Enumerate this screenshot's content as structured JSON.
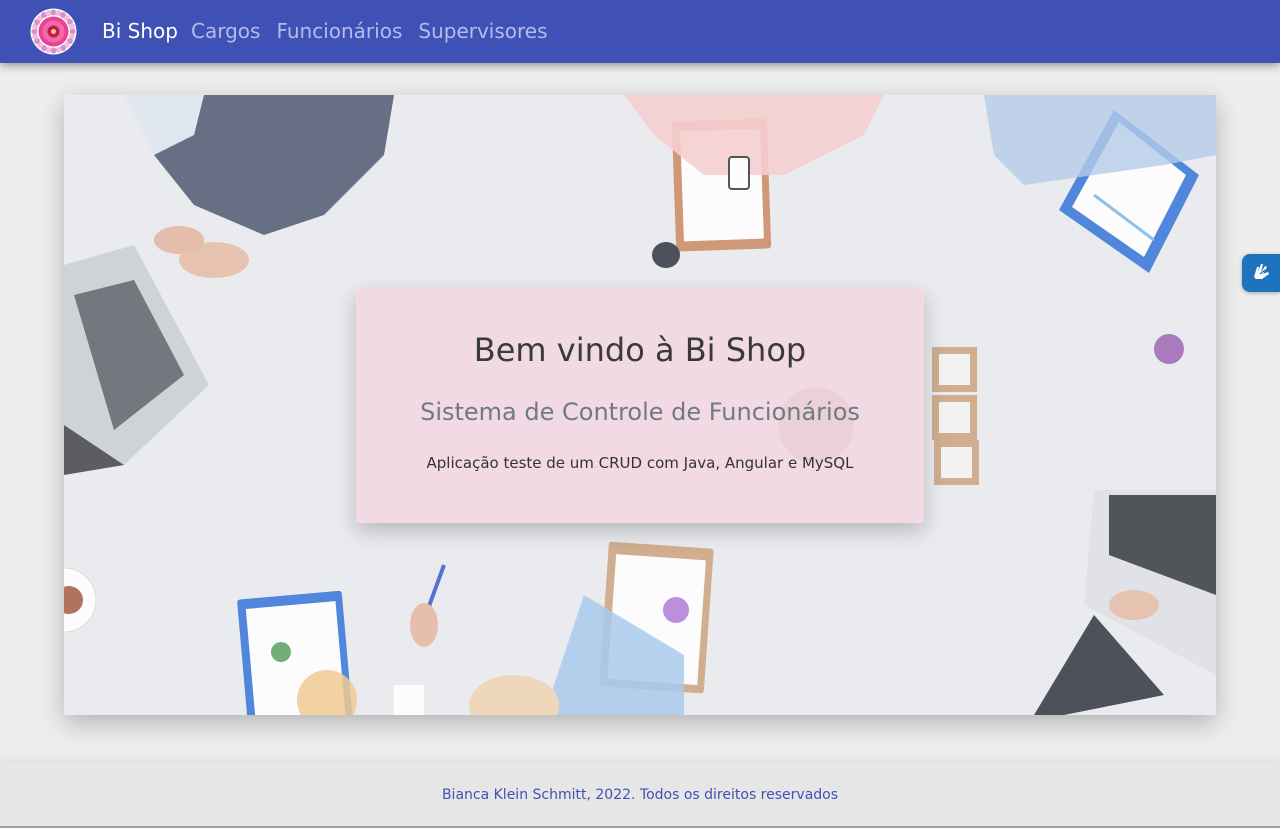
{
  "navbar": {
    "brand": "Bi Shop",
    "links": [
      {
        "label": "Cargos"
      },
      {
        "label": "Funcionários"
      },
      {
        "label": "Supervisores"
      }
    ],
    "logo_icon": "flower-mandala-icon"
  },
  "hero": {
    "title": "Bem vindo à Bi Shop",
    "subtitle": "Sistema de Controle de Funcionários",
    "description": "Aplicação teste de um CRUD com Java, Angular e MySQL",
    "background_image": "office-meeting-top-view"
  },
  "accessibility_widget": {
    "icon": "sign-language-hands-icon"
  },
  "footer": {
    "text": "Bianca Klein Schmitt, 2022. Todos os direitos reservados"
  },
  "colors": {
    "primary": "#3f51b5",
    "nav_link_inactive": "#b3bcea",
    "card_background": "#f3d5e2",
    "accessibility_blue": "#1e73be"
  }
}
